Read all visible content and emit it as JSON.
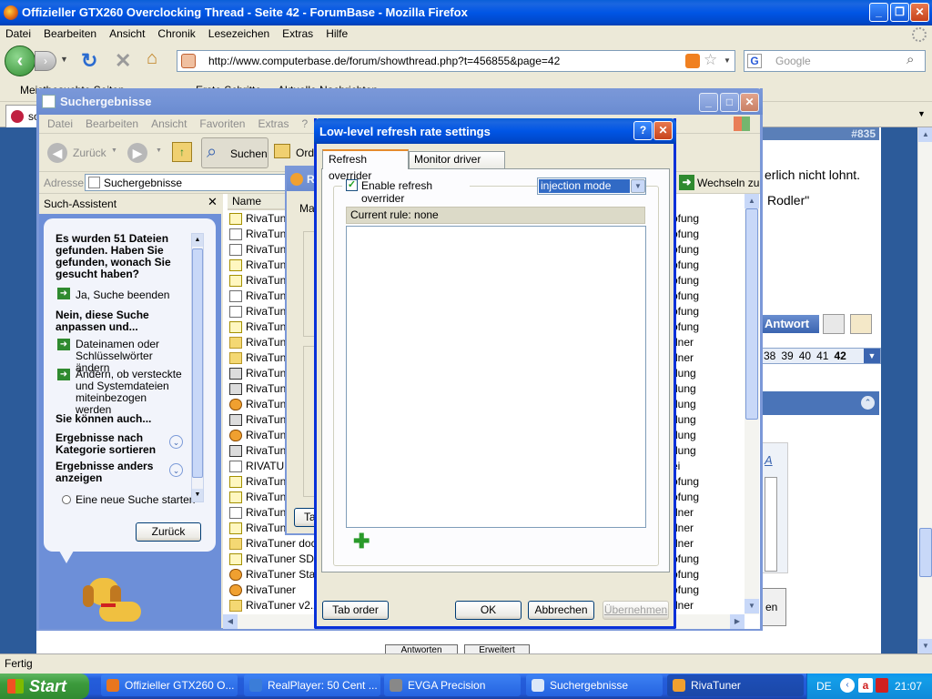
{
  "firefox": {
    "title": "Offizieller GTX260 Overclocking Thread - Seite 42 - ForumBase - Mozilla Firefox",
    "menu": [
      "Datei",
      "Bearbeiten",
      "Ansicht",
      "Chronik",
      "Lesezeichen",
      "Extras",
      "Hilfe"
    ],
    "url": "http://www.computerbase.de/forum/showthread.php?t=456855&page=42",
    "search_placeholder": "Google",
    "bookmarks": [
      "Meistbesuchte Seiten",
      "Erste Schritte",
      "Aktuelle Nachrichten"
    ],
    "tab_label": "so",
    "status": "Fertig",
    "page": {
      "thread_num": "#835",
      "text1": "erlich nicht lohnt.",
      "text2": "Rodler\"",
      "reply_label": "Antwort",
      "pages": [
        "38",
        "39",
        "40",
        "41",
        "42"
      ],
      "current_page": "42",
      "en_label": "en",
      "bottom_buttons": [
        "Antworten",
        "Erweitert"
      ]
    }
  },
  "explorer": {
    "title": "Suchergebnisse",
    "menu": [
      "Datei",
      "Bearbeiten",
      "Ansicht",
      "Favoriten",
      "Extras",
      "?"
    ],
    "back_label": "Zurück",
    "search_label": "Suchen",
    "folders_label": "Ord",
    "address_label": "Adresse",
    "address_value": "Suchergebnisse",
    "go_label": "Wechseln zu",
    "assistant": {
      "title": "Such-Assistent",
      "found_text": "Es wurden 51 Dateien gefunden. Haben Sie gefunden, wonach Sie gesucht haben?",
      "yes_option": "Ja, Suche beenden",
      "refine_heading": "Nein, diese Suche anpassen und...",
      "opt1": "Dateinamen oder Schlüsselwörter ändern",
      "opt2": "Ändern, ob versteckte und Systemdateien miteinbezogen werden",
      "also_heading": "Sie können auch...",
      "sort_label": "Ergebnisse nach Kategorie sortieren",
      "view_label": "Ergebnisse anders anzeigen",
      "new_search": "Eine neue Suche starten",
      "back_button": "Zurück"
    },
    "column_name": "Name",
    "rows": [
      {
        "name": "RivaTuner",
        "icon": "q",
        "right": "ofung"
      },
      {
        "name": "RivaTuner",
        "icon": "d",
        "right": "ofung"
      },
      {
        "name": "RivaTuner",
        "icon": "d",
        "right": "ofung"
      },
      {
        "name": "RivaTuner",
        "icon": "q",
        "right": "ofung"
      },
      {
        "name": "RivaTuner",
        "icon": "q",
        "right": "ofung"
      },
      {
        "name": "RivaTuner",
        "icon": "d",
        "right": "ofung"
      },
      {
        "name": "RivaTuner",
        "icon": "d",
        "right": "ofung"
      },
      {
        "name": "RivaTuner",
        "icon": "q",
        "right": "ofung"
      },
      {
        "name": "RivaTuner",
        "icon": "f",
        "right": "dner"
      },
      {
        "name": "RivaTuner",
        "icon": "f",
        "right": "dner"
      },
      {
        "name": "RivaTuner",
        "icon": "z",
        "right": "dung"
      },
      {
        "name": "RivaTuner",
        "icon": "z",
        "right": "dung"
      },
      {
        "name": "RivaTuner",
        "icon": "o",
        "right": "dung"
      },
      {
        "name": "RivaTuner",
        "icon": "z",
        "right": "dung"
      },
      {
        "name": "RivaTuner",
        "icon": "o",
        "right": "dung"
      },
      {
        "name": "RivaTuner",
        "icon": "z",
        "right": "dung"
      },
      {
        "name": "RIVATUN",
        "icon": "d",
        "right": "ei"
      },
      {
        "name": "RivaTuner",
        "icon": "q",
        "right": "ofung"
      },
      {
        "name": "RivaTuner",
        "icon": "q",
        "right": "ofung"
      },
      {
        "name": "RivaTuner",
        "icon": "d",
        "right": "dner"
      },
      {
        "name": "RivaTuner",
        "icon": "q",
        "right": "dner"
      },
      {
        "name": "RivaTuner docu",
        "icon": "f",
        "right": "dner"
      },
      {
        "name": "RivaTuner SDK",
        "icon": "q",
        "right": "ofung"
      },
      {
        "name": "RivaTuner Statis",
        "icon": "o",
        "right": "ofung"
      },
      {
        "name": "RivaTuner",
        "icon": "o",
        "right": "ofung"
      },
      {
        "name": "RivaTuner v2.2",
        "icon": "f",
        "right": "dner"
      }
    ]
  },
  "rivatuner_bg": {
    "title_partial": "R",
    "tab_partial": "Ma",
    "btn_partial": "Ta"
  },
  "dialog": {
    "title": "Low-level refresh rate settings",
    "tabs": [
      "Refresh overrider",
      "Monitor driver wizard"
    ],
    "enable_label": "Enable refresh overrider",
    "mode_value": "injection mode",
    "rule_label": "Current rule: none",
    "tab_order": "Tab order",
    "ok": "OK",
    "cancel": "Abbrechen",
    "apply": "Übernehmen"
  },
  "taskbar": {
    "start": "Start",
    "tasks": [
      {
        "label": "Offizieller GTX260 O...",
        "color": "#e8761e"
      },
      {
        "label": "RealPlayer: 50 Cent ...",
        "color": "#3b7dd8"
      },
      {
        "label": "EVGA Precision",
        "color": "#888888"
      },
      {
        "label": "Suchergebnisse",
        "color": "#dce8f8"
      },
      {
        "label": "RivaTuner",
        "color": "#f0a030"
      }
    ],
    "lang": "DE",
    "time": "21:07"
  }
}
